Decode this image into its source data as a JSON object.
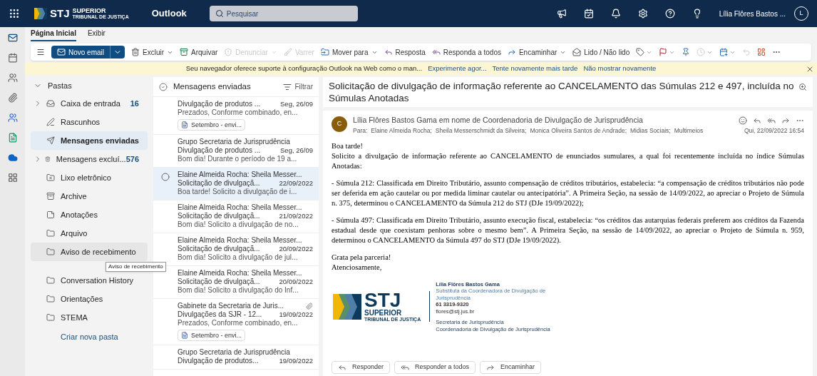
{
  "top_bar": {
    "logo": {
      "name": "STJ",
      "line1": "SUPERIOR",
      "line2": "TRIBUNAL DE JUSTIÇA"
    },
    "app_name": "Outlook",
    "search": {
      "placeholder": "Pesquisar"
    },
    "user_name": "Lília Flôres Bastos ...",
    "avatar_initial": "L"
  },
  "tabs": [
    {
      "label": "Página Inicial",
      "selected": true
    },
    {
      "label": "Exibir",
      "selected": false
    }
  ],
  "toolbar": {
    "new_email": "Novo email",
    "actions": [
      {
        "label": "Excluir",
        "disabled": false,
        "menu": true
      },
      {
        "label": "Arquivar",
        "disabled": false,
        "menu": false
      },
      {
        "label": "Denunciar",
        "disabled": true,
        "menu": true
      },
      {
        "label": "Varrer",
        "disabled": true,
        "menu": false
      },
      {
        "label": "Mover para",
        "disabled": false,
        "menu": true
      },
      {
        "label": "Resposta",
        "disabled": false,
        "menu": false
      },
      {
        "label": "Responda a todos",
        "disabled": false,
        "menu": false
      },
      {
        "label": "Encaminhar",
        "disabled": false,
        "menu": true
      },
      {
        "label": "Lido / Não lido",
        "disabled": false,
        "menu": false
      }
    ],
    "icon_tools": [
      {
        "disabled": false,
        "menu": true
      },
      {
        "disabled": false,
        "menu": true
      },
      {
        "disabled": false,
        "menu": false
      },
      {
        "disabled": true,
        "menu": true
      },
      {
        "disabled": false,
        "menu": true
      },
      {
        "disabled": true,
        "menu": false
      },
      {
        "disabled": false,
        "menu": false
      },
      {
        "disabled": false,
        "menu": false
      }
    ]
  },
  "banner": {
    "message": "Seu navegador oferece suporte à configuração Outlook na Web como o man...",
    "links": [
      "Experimente agor...",
      "Tente novamente mais tarde",
      "Não mostrar novamente"
    ]
  },
  "folders": {
    "header": "Pastas",
    "items": [
      {
        "label": "Caixa de entrada",
        "count": "16",
        "expandable": true,
        "selected": false,
        "hovered": false
      },
      {
        "label": "Rascunhos",
        "expandable": false,
        "selected": false,
        "hovered": false
      },
      {
        "label": "Mensagens enviadas",
        "expandable": false,
        "selected": true,
        "hovered": false
      },
      {
        "label": "Mensagens excluí...",
        "count": "576",
        "expandable": true,
        "selected": false,
        "hovered": false
      },
      {
        "label": "Lixo eletrônico",
        "expandable": false,
        "selected": false,
        "hovered": false
      },
      {
        "label": "Archive",
        "expandable": false,
        "selected": false,
        "hovered": false
      },
      {
        "label": "Anotações",
        "expandable": false,
        "selected": false,
        "hovered": false
      },
      {
        "label": "Arquivo",
        "expandable": false,
        "selected": false,
        "hovered": false
      },
      {
        "label": "Aviso de recebimento",
        "expandable": false,
        "selected": false,
        "hovered": true,
        "tooltip": "Aviso de recebimento"
      },
      {
        "label": "Conversation History",
        "expandable": false,
        "selected": false,
        "hovered": false
      },
      {
        "label": "Orientações",
        "expandable": false,
        "selected": false,
        "hovered": false
      },
      {
        "label": "STEMA",
        "expandable": false,
        "selected": false,
        "hovered": false
      }
    ],
    "create_link": "Criar nova pasta"
  },
  "message_list": {
    "title": "Mensagens enviadas",
    "filter": "Filtrar",
    "items": [
      {
        "subject": "Divulgação de produtos ...",
        "date": "Seg, 26/09",
        "preview": "Prezados, Conforme combinado, en...",
        "attachment": "Setembro - envi...",
        "has_attachment_icon": false,
        "selected": false
      },
      {
        "sender": "Grupo Secretaria de Jurisprudência",
        "has_attachment_icon": false,
        "subject": "Divulgação de produtos ...",
        "date": "Seg, 26/09",
        "preview": "Bom dia! Durante o período de 19 a...",
        "selected": false
      },
      {
        "sender": "Elaine Almeida Rocha: Sheila Messer...",
        "has_attachment_icon": false,
        "subject": "Solicitação de divulgaçã...",
        "date": "22/09/2022",
        "preview": "Boa tarde! Solicito a divulgação de i...",
        "selected": true
      },
      {
        "sender": "Elaine Almeida Rocha: Sheila Messer...",
        "has_attachment_icon": false,
        "subject": "Solicitação de divulgaçã...",
        "date": "21/09/2022",
        "preview": "Bom dia! Solicito a divulgação de no...",
        "selected": false
      },
      {
        "sender": "Elaine Almeida Rocha: Sheila Messer...",
        "has_attachment_icon": false,
        "subject": "Solicitação de divulgaçã...",
        "date": "20/09/2022",
        "preview": "Bom dia! Solicito a divulgação de jul...",
        "selected": false
      },
      {
        "sender": "Elaine Almeida Rocha: Sheila Messer...",
        "has_attachment_icon": false,
        "subject": "Solicitação de divulgaçã...",
        "date": "20/09/2022",
        "preview": "Bom dia! Solicito a divulgação do Inf...",
        "selected": false
      },
      {
        "sender": "Gabinete da Secretaria de Juris...",
        "has_attachment_icon": true,
        "subject": "Divulgações da SJR - 12...",
        "date": "19/09/2022",
        "preview": "Prezados, Conforme combinado, en...",
        "attachment": "Setembro - envi...",
        "selected": false
      },
      {
        "sender": "Grupo Secretaria de Jurisprudência",
        "has_attachment_icon": false,
        "subject": "Divulgação de produtos...",
        "date": "19/09/2022",
        "selected": false
      }
    ]
  },
  "reading_pane": {
    "subject": "Solicitação de divulgação de informação referente ao CANCELAMENTO das Súmulas 212 e 497, incluída no Súmulas Anotadas",
    "message": {
      "avatar_initial": "C",
      "from": "Lília Flôres Bastos Gama em nome de Coordenadoria de Divulgação de Jurisprudência",
      "to_label": "Para:",
      "to": [
        "Elaine Almeida Rocha;",
        "Sheila Messerschmidt da Silveira;",
        "Monica Oliveira Santos de Andrade;",
        "Midias Sociais;",
        "Multimeios"
      ],
      "date": "Qui, 22/09/2022 16:54",
      "body": [
        [
          "Boa tarde!",
          "Solicito a divulgação de informação referente ao CANCELAMENTO de enunciados sumulares, a qual foi recentemente incluída no índice Súmulas Anotadas:"
        ],
        [
          "- Súmula 212: Classificada em Direito Tributário, assunto compensação de créditos tributários, estabelecia: “a compensação de créditos tributários não pode ser deferida em ação cautelar ou por medida liminar cautelar ou antecipatória”. A Primeira Seção, na sessão de 14/09/2022, ao apreciar o Projeto de Súmula n. 375, determinou o CANCELAMENTO da Súmula 212 do STJ (DJe 19/09/2022);"
        ],
        [
          "- Súmula 497: Classificada em Direito Tributário, assunto execução fiscal, estabelecia: “os créditos das autarquias federais preferem aos créditos da Fazenda estadual desde que coexistam penhoras sobre o mesmo bem”. A Primeira Seção, na sessão de 14/09/2022, ao apreciar o Projeto de Súmula n. 959, determinou o CANCELAMENTO da Súmula 497 do STJ (DJe 19/09/2022)."
        ],
        [
          "Grata pela parceria!",
          "Atenciosamente,"
        ]
      ],
      "signature": {
        "logo": {
          "name": "STJ",
          "line1": "SUPERIOR",
          "line2": "TRIBUNAL DE JUSTIÇA"
        },
        "name": "Lília Flôres Bastos Gama",
        "role": "Substituta da Coordenadora de Divulgação de Jurisprudência",
        "phone": "61 3319-9320",
        "email": "flores@stj.jus.br",
        "department": [
          "Secretaria de Jurisprudência",
          "Coordenadoria de Divulgação de Jurisprudência"
        ]
      }
    },
    "buttons": [
      "Responder",
      "Responder a todos",
      "Encaminhar"
    ]
  }
}
